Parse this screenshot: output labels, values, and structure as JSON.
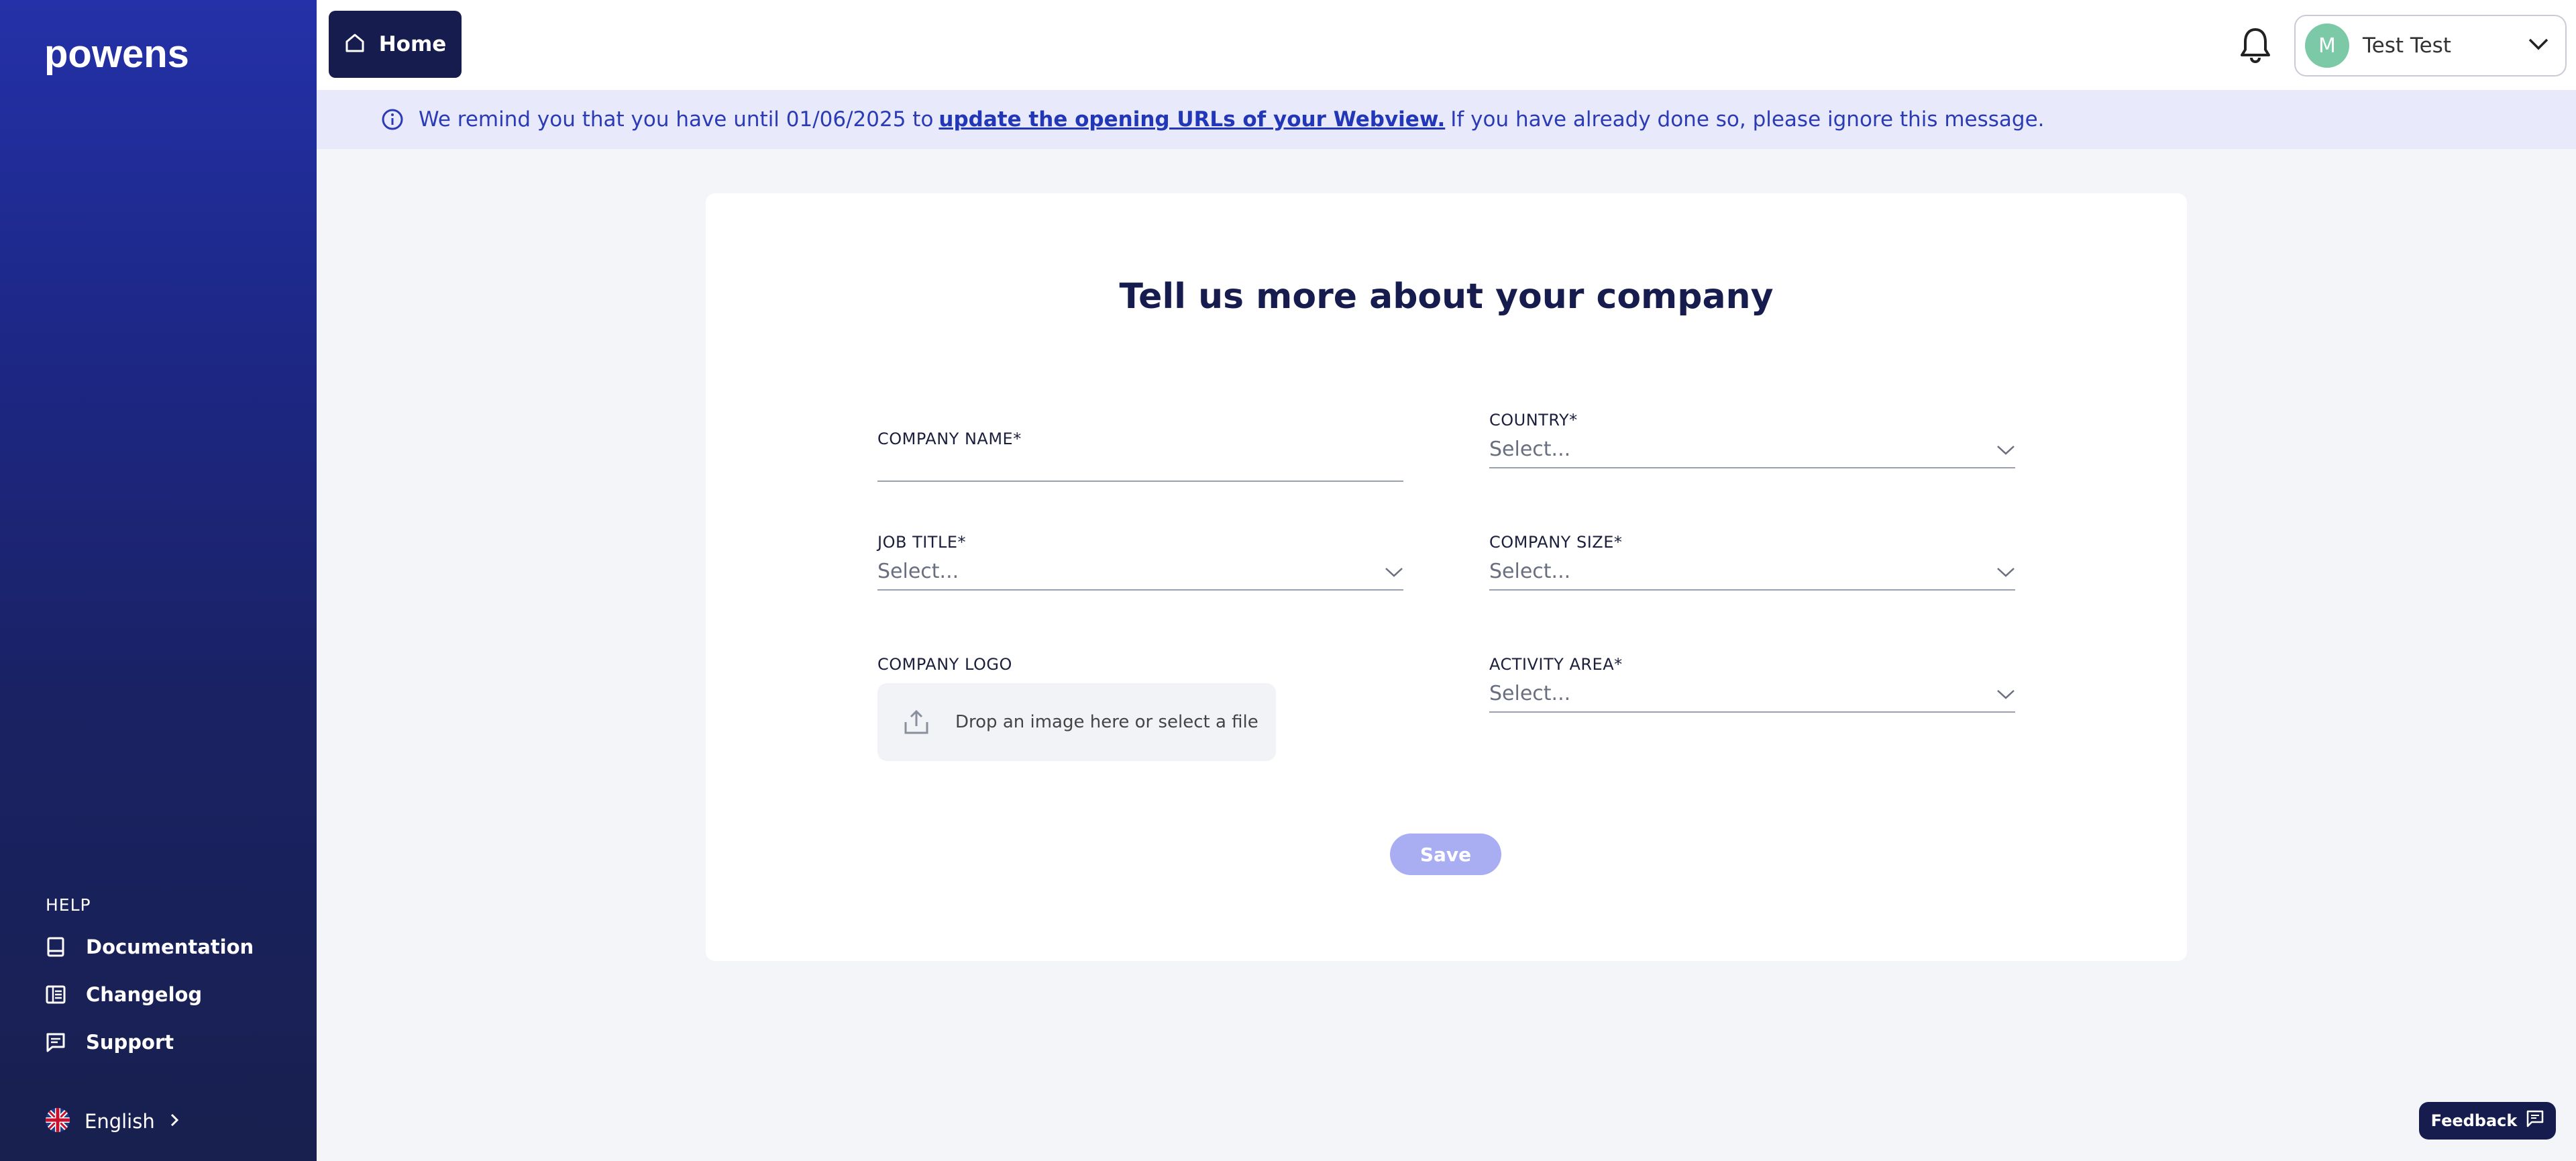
{
  "brand": {
    "name": "powens"
  },
  "sidebar": {
    "help_title": "HELP",
    "items": [
      {
        "label": "Documentation",
        "icon": "book-icon"
      },
      {
        "label": "Changelog",
        "icon": "changelog-icon"
      },
      {
        "label": "Support",
        "icon": "chat-icon"
      }
    ],
    "language": {
      "label": "English",
      "flag": "uk-flag-icon"
    }
  },
  "topbar": {
    "home_label": "Home",
    "user": {
      "initial": "M",
      "name": "Test Test"
    }
  },
  "banner": {
    "text_before": "We remind you that you have until 01/06/2025 to",
    "link": "update the opening URLs of your Webview.",
    "text_after": "If you have already done so, please ignore this message."
  },
  "form": {
    "title": "Tell us more about your company",
    "company_name_label": "COMPANY NAME*",
    "company_name_value": "",
    "country_label": "COUNTRY*",
    "country_value": "Select...",
    "job_title_label": "JOB TITLE*",
    "job_title_value": "Select...",
    "company_size_label": "COMPANY SIZE*",
    "company_size_value": "Select...",
    "company_logo_label": "COMPANY LOGO",
    "upload_text": "Drop an image here or select a file",
    "activity_area_label": "ACTIVITY AREA*",
    "activity_area_value": "Select...",
    "save_label": "Save"
  },
  "feedback_label": "Feedback",
  "colors": {
    "sidebar_top": "#2431a8",
    "sidebar_bottom": "#18204f",
    "accent": "#161c4e",
    "banner_bg": "#e8eafb",
    "save_disabled": "#a9aef3",
    "avatar": "#7cc9a7"
  }
}
